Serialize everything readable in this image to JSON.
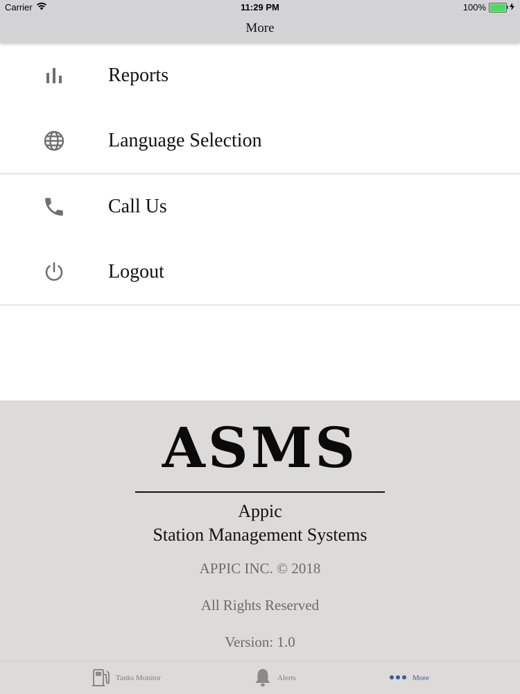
{
  "status_bar": {
    "carrier": "Carrier",
    "time": "11:29 PM",
    "battery": "100%",
    "battery_level": 1.0
  },
  "nav": {
    "title": "More"
  },
  "menu": {
    "items": [
      {
        "label": "Reports",
        "icon": "bar-chart-icon"
      },
      {
        "label": "Language Selection",
        "icon": "globe-icon"
      },
      {
        "label": "Call Us",
        "icon": "phone-icon"
      },
      {
        "label": "Logout",
        "icon": "power-icon"
      }
    ]
  },
  "about": {
    "logo": "ASMS",
    "company_line1": "Appic",
    "company_line2": "Station Management Systems",
    "copyright": "APPIC INC. © 2018",
    "rights": "All Rights Reserved",
    "version": "Version: 1.0"
  },
  "tabs": [
    {
      "label": "Tanks Monitor",
      "icon": "fuel-pump-icon"
    },
    {
      "label": "Alerts",
      "icon": "bell-icon"
    },
    {
      "label": "More",
      "icon": "more-dots-icon"
    }
  ],
  "colors": {
    "bar_background": "#d4d4d6",
    "footer_background": "#dcdbda",
    "icon_gray": "#6f6f6f",
    "active_tab": "#3c5a98",
    "battery_green": "#4cd964"
  }
}
